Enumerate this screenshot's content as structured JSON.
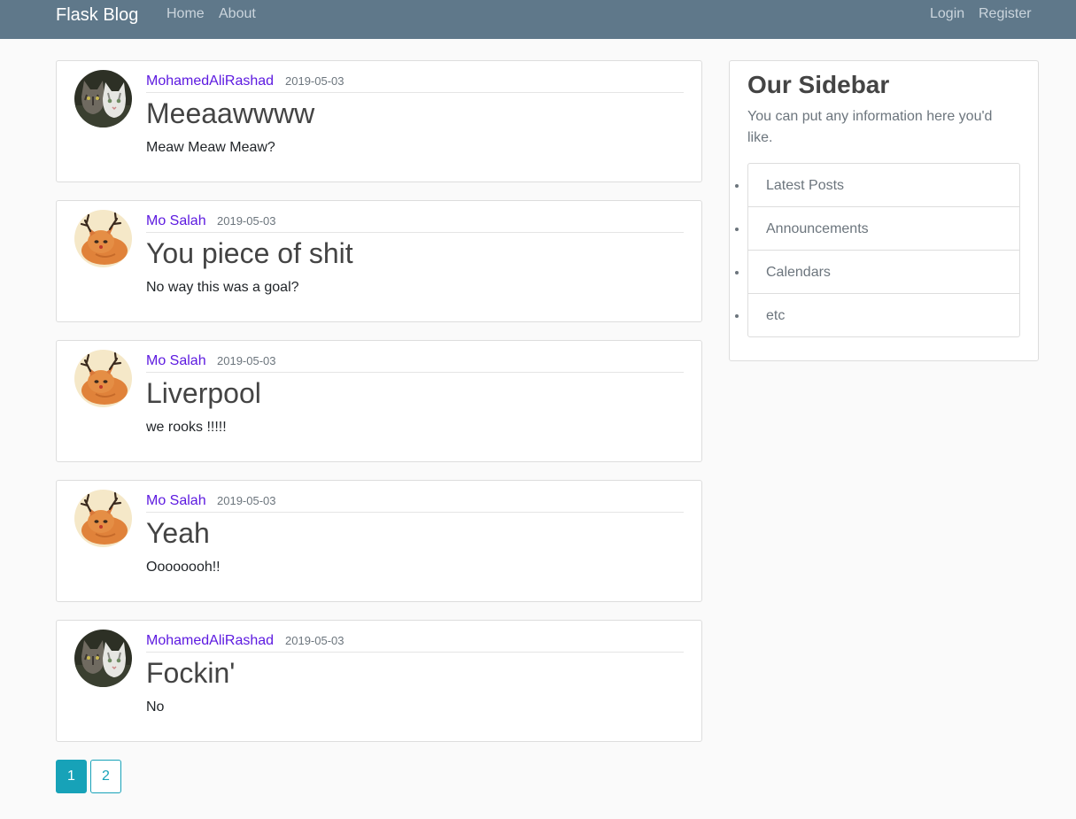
{
  "navbar": {
    "brand": "Flask Blog",
    "left_links": [
      "Home",
      "About"
    ],
    "right_links": [
      "Login",
      "Register"
    ]
  },
  "posts": [
    {
      "author": "MohamedAliRashad",
      "date": "2019-05-03",
      "title": "Meeaawwww",
      "content": "Meaw Meaw Meaw?",
      "avatar": "cats-avatar"
    },
    {
      "author": "Mo Salah",
      "date": "2019-05-03",
      "title": "You piece of shit",
      "content": "No way this was a goal?",
      "avatar": "reindeer-cat-avatar"
    },
    {
      "author": "Mo Salah",
      "date": "2019-05-03",
      "title": "Liverpool",
      "content": "we rooks !!!!!",
      "avatar": "reindeer-cat-avatar"
    },
    {
      "author": "Mo Salah",
      "date": "2019-05-03",
      "title": "Yeah",
      "content": "Oooooooh!!",
      "avatar": "reindeer-cat-avatar"
    },
    {
      "author": "MohamedAliRashad",
      "date": "2019-05-03",
      "title": "Fockin'",
      "content": "No",
      "avatar": "cats-avatar"
    }
  ],
  "sidebar": {
    "title": "Our Sidebar",
    "text": "You can put any information here you'd like.",
    "items": [
      "Latest Posts",
      "Announcements",
      "Calendars",
      "etc"
    ]
  },
  "pagination": {
    "pages": [
      "1",
      "2"
    ],
    "active": "1"
  },
  "colors": {
    "navbar": "#5f788a",
    "author_link": "#5d1ae0",
    "pagination_accent": "#17a2b8"
  }
}
